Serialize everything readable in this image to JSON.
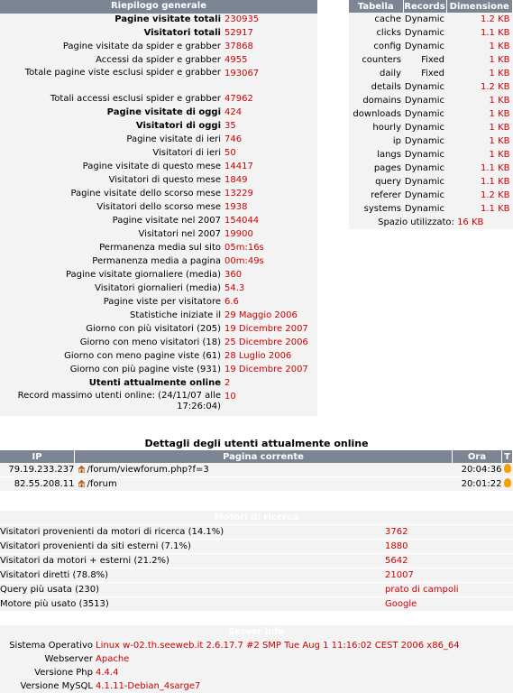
{
  "summary": {
    "title": "Riepilogo generale",
    "rows": [
      {
        "label": "Pagine visitate totali",
        "value": "230935",
        "bold": true
      },
      {
        "label": "Visitatori totali",
        "value": "52917",
        "bold": true
      },
      {
        "label": "Pagine visitate da spider e grabber",
        "value": "37868"
      },
      {
        "label": "Accessi da spider e grabber",
        "value": "4955"
      },
      {
        "label": "Totale pagine viste esclusi spider e grabber",
        "value": "193067",
        "tall": true
      },
      {
        "label": "Totali accessi esclusi spider e grabber",
        "value": "47962"
      },
      {
        "label": "Pagine visitate di oggi",
        "value": "424",
        "bold": true
      },
      {
        "label": "Visitatori di oggi",
        "value": "35",
        "bold": true
      },
      {
        "label": "Pagine visitate di ieri",
        "value": "746"
      },
      {
        "label": "Visitatori di ieri",
        "value": "50"
      },
      {
        "label": "Pagine visitate di questo mese",
        "value": "14417"
      },
      {
        "label": "Visitatori di questo mese",
        "value": "1849"
      },
      {
        "label": "Pagine visitate dello scorso mese",
        "value": "13229"
      },
      {
        "label": "Visitatori dello scorso mese",
        "value": "1938"
      },
      {
        "label": "Pagine visitate nel 2007",
        "value": "154044"
      },
      {
        "label": "Visitatori nel 2007",
        "value": "19900"
      },
      {
        "label": "Permanenza media sul sito",
        "value": "05m:16s"
      },
      {
        "label": "Permanenza media a pagina",
        "value": "00m:49s"
      },
      {
        "label": "Pagine visitate giornaliere (media)",
        "value": "360"
      },
      {
        "label": "Visitatori giornalieri (media)",
        "value": "54.3"
      },
      {
        "label": "Pagine viste per visitatore",
        "value": "6.6"
      },
      {
        "label": "Statistiche iniziate il",
        "value": "29 Maggio 2006"
      },
      {
        "label": "Giorno con più visitatori (205)",
        "value": "19 Dicembre 2007"
      },
      {
        "label": "Giorno con meno visitatori (18)",
        "value": "25 Dicembre 2006"
      },
      {
        "label": "Giorno con meno pagine viste (61)",
        "value": "28 Luglio 2006"
      },
      {
        "label": "Giorno con più pagine viste (931)",
        "value": "19 Dicembre 2007"
      },
      {
        "label": "Utenti attualmente online",
        "value": "2",
        "bold": true
      },
      {
        "label": "Record massimo utenti online: (24/11/07 alle 17:26:04)",
        "value": "10",
        "tall": true
      }
    ]
  },
  "tables": {
    "headers": [
      "Tabella",
      "Records",
      "Dimensione"
    ],
    "rows": [
      {
        "name": "cache",
        "records": "Dynamic",
        "size": "1.2 KB"
      },
      {
        "name": "clicks",
        "records": "Dynamic",
        "size": "1.1 KB"
      },
      {
        "name": "config",
        "records": "Dynamic",
        "size": "1 KB"
      },
      {
        "name": "counters",
        "records": "Fixed",
        "size": "1 KB"
      },
      {
        "name": "daily",
        "records": "Fixed",
        "size": "1 KB"
      },
      {
        "name": "details",
        "records": "Dynamic",
        "size": "1.2 KB"
      },
      {
        "name": "domains",
        "records": "Dynamic",
        "size": "1 KB"
      },
      {
        "name": "downloads",
        "records": "Dynamic",
        "size": "1 KB"
      },
      {
        "name": "hourly",
        "records": "Dynamic",
        "size": "1 KB"
      },
      {
        "name": "ip",
        "records": "Dynamic",
        "size": "1 KB"
      },
      {
        "name": "langs",
        "records": "Dynamic",
        "size": "1 KB"
      },
      {
        "name": "pages",
        "records": "Dynamic",
        "size": "1.1 KB"
      },
      {
        "name": "query",
        "records": "Dynamic",
        "size": "1.1 KB"
      },
      {
        "name": "referer",
        "records": "Dynamic",
        "size": "1.2 KB"
      },
      {
        "name": "systems",
        "records": "Dynamic",
        "size": "1.1 KB"
      }
    ],
    "space_label": "Spazio utilizzato:",
    "space_value": "16 KB"
  },
  "online": {
    "title": "Dettagli degli utenti attualmente online",
    "headers": [
      "IP",
      "Pagina corrente",
      "Ora",
      "T"
    ],
    "rows": [
      {
        "ip": "79.19.233.237",
        "page": "/forum/viewforum.php?f=3",
        "time": "20:04:36"
      },
      {
        "ip": "82.55.208.11",
        "page": "/forum",
        "time": "20:01:22"
      }
    ]
  },
  "motori": {
    "title": "Motori di ricerca",
    "rows": [
      {
        "label": "Visitatori provenienti da motori di ricerca (14.1%)",
        "value": "3762"
      },
      {
        "label": "Visitatori provenienti da siti esterni (7.1%)",
        "value": "1880"
      },
      {
        "label": "Visitatori da motori + esterni (21.2%)",
        "value": "5642"
      },
      {
        "label": "Visitatori diretti (78.8%)",
        "value": "21007"
      },
      {
        "label": "Query più usata (230)",
        "value": "prato di campoli"
      },
      {
        "label": "Motore più usato (3513)",
        "value": "Google"
      }
    ]
  },
  "server": {
    "title": "Server info",
    "rows": [
      {
        "label": "Sistema Operativo",
        "value": "Linux w-02.th.seeweb.it 2.6.17.7 #2 SMP Tue Aug 1 11:16:02 CEST 2006 x86_64"
      },
      {
        "label": "Webserver",
        "value": "Apache"
      },
      {
        "label": "Versione Php",
        "value": "4.4.4"
      },
      {
        "label": "Versione MySQL",
        "value": "4.1.11-Debian_4sarge7"
      }
    ]
  },
  "colors": {
    "header_bg": "#7c8594",
    "value": "#cc0000",
    "row_bg": "#f3f3f3"
  },
  "icons": {
    "home": "home-icon",
    "location": "location-pin-icon"
  }
}
